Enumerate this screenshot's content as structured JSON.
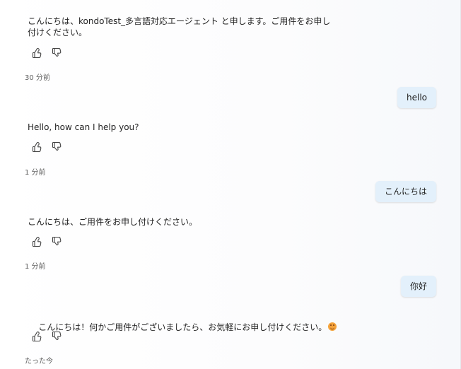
{
  "messages": [
    {
      "role": "bot",
      "text": "こんにちは、kondoTest_多言語対応エージェント と申します。ご用件をお申し\n付けください。",
      "timestamp": "30 分前"
    },
    {
      "role": "user",
      "text": "hello"
    },
    {
      "role": "bot",
      "text": "Hello, how can I help you?",
      "timestamp": "1 分前"
    },
    {
      "role": "user",
      "text": "こんにちは"
    },
    {
      "role": "bot",
      "text": "こんにちは、ご用件をお申し付けください。",
      "timestamp": "1 分前"
    },
    {
      "role": "user",
      "text": "你好"
    },
    {
      "role": "bot",
      "text": "こんにちは！何かご用件がございましたら、お気軽にお申し付けください。",
      "emoji": "smiling-face-icon",
      "timestamp": "たった今"
    }
  ],
  "icons": {
    "thumbs_up": "thumbs-up-icon",
    "thumbs_down": "thumbs-down-icon"
  },
  "colors": {
    "user_bubble": "#e3f0fb",
    "timestamp": "#616161"
  }
}
